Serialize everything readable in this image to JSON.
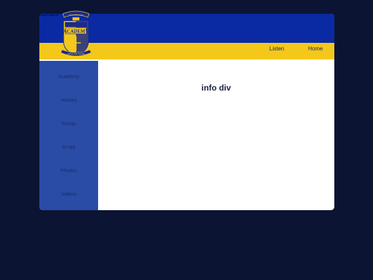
{
  "header": {
    "crest_top": "Saint Edward's",
    "crest_main": "ACADEMY",
    "crest_ribbon": "CROSS AND SWORD",
    "corner_text": "Saint Edward's"
  },
  "nav": {
    "listen": "Listen",
    "home": "Home"
  },
  "sidebar": {
    "items": [
      {
        "label": "Academy"
      },
      {
        "label": "History"
      },
      {
        "label": "Songs"
      },
      {
        "label": "Script"
      },
      {
        "label": "Photos"
      },
      {
        "label": "Videos"
      }
    ]
  },
  "main": {
    "title": "info div"
  },
  "colors": {
    "background": "#0c1434",
    "header_blue": "#0a2aa3",
    "header_yellow": "#f3c81b",
    "sidebar": "#2a4ca6",
    "content": "#ffffff"
  }
}
